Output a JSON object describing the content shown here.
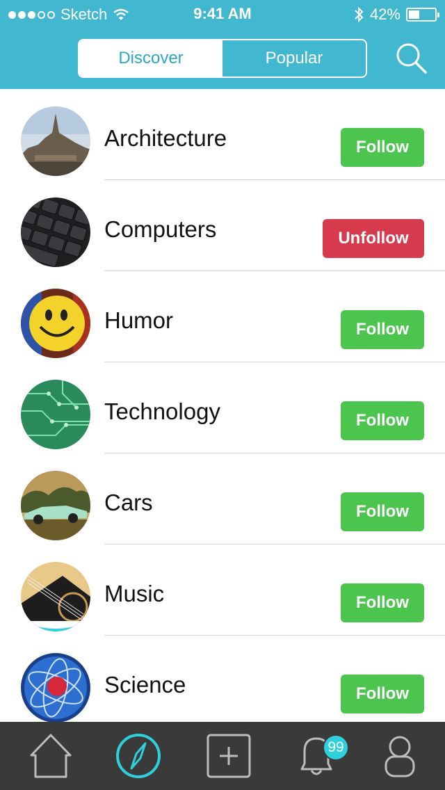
{
  "status_bar": {
    "carrier": "Sketch",
    "time": "9:41 AM",
    "battery": "42%",
    "battery_level": 0.42,
    "signal_bars_filled": 3,
    "signal_bars_total": 5
  },
  "header": {
    "segments": [
      {
        "label": "Discover",
        "active": true
      },
      {
        "label": "Popular",
        "active": false
      }
    ],
    "search_icon": "search-icon",
    "accent_color": "#41b8cf"
  },
  "topics": [
    {
      "name": "Architecture",
      "action": "Follow",
      "state": "follow"
    },
    {
      "name": "Computers",
      "action": "Unfollow",
      "state": "unfollow"
    },
    {
      "name": "Humor",
      "action": "Follow",
      "state": "follow"
    },
    {
      "name": "Technology",
      "action": "Follow",
      "state": "follow"
    },
    {
      "name": "Cars",
      "action": "Follow",
      "state": "follow"
    },
    {
      "name": "Music",
      "action": "Follow",
      "state": "follow"
    },
    {
      "name": "Science",
      "action": "Follow",
      "state": "follow"
    }
  ],
  "colors": {
    "follow": "#4cc54f",
    "unfollow": "#d63a4c",
    "tab_active": "#2fd0dd"
  },
  "tabbar": {
    "tabs": [
      {
        "icon": "home-icon"
      },
      {
        "icon": "compass-icon",
        "active": true
      },
      {
        "icon": "add-icon"
      },
      {
        "icon": "bell-icon"
      },
      {
        "icon": "profile-icon"
      }
    ],
    "notification_count": "99"
  }
}
